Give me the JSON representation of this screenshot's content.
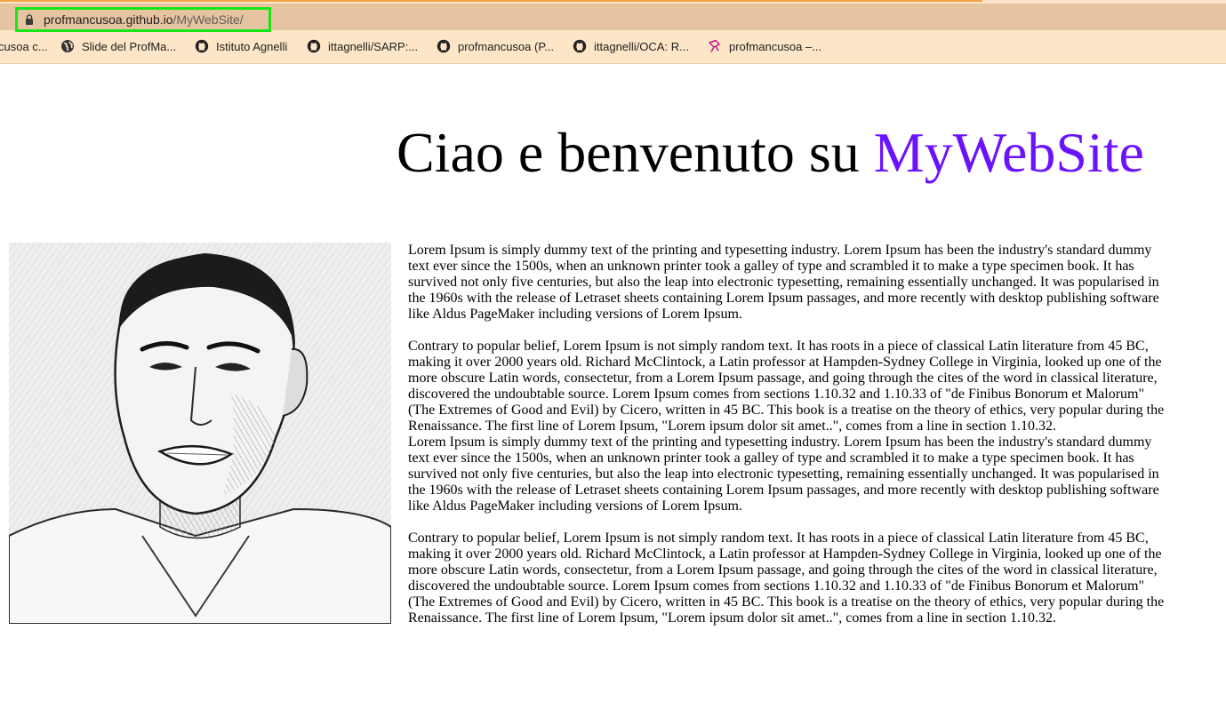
{
  "browser": {
    "url_domain": "profmancusoa.github.io",
    "url_path": "/MyWebSite/",
    "bookmarks": [
      {
        "label": "cusoa c...",
        "icon": "none"
      },
      {
        "label": "Slide del ProfMa...",
        "icon": "globe-icon"
      },
      {
        "label": "Istituto Agnelli",
        "icon": "github-icon"
      },
      {
        "label": "ittagnelli/SARP:...",
        "icon": "github-icon"
      },
      {
        "label": "profmancusoa (P...",
        "icon": "github-icon"
      },
      {
        "label": "ittagnelli/OCA: R...",
        "icon": "github-icon"
      },
      {
        "label": "profmancusoa –...",
        "icon": "pen-icon"
      }
    ]
  },
  "page": {
    "title_prefix": "Ciao e benvenuto su ",
    "title_brand": "MyWebSite",
    "paragraphs": [
      "Lorem Ipsum is simply dummy text of the printing and typesetting industry. Lorem Ipsum has been the industry's standard dummy text ever since the 1500s, when an unknown printer took a galley of type and scrambled it to make a type specimen book. It has survived not only five centuries, but also the leap into electronic typesetting, remaining essentially unchanged. It was popularised in the 1960s with the release of Letraset sheets containing Lorem Ipsum passages, and more recently with desktop publishing software like Aldus PageMaker including versions of Lorem Ipsum.",
      "Contrary to popular belief, Lorem Ipsum is not simply random text. It has roots in a piece of classical Latin literature from 45 BC, making it over 2000 years old. Richard McClintock, a Latin professor at Hampden-Sydney College in Virginia, looked up one of the more obscure Latin words, consectetur, from a Lorem Ipsum passage, and going through the cites of the word in classical literature, discovered the undoubtable source. Lorem Ipsum comes from sections 1.10.32 and 1.10.33 of \"de Finibus Bonorum et Malorum\" (The Extremes of Good and Evil) by Cicero, written in 45 BC. This book is a treatise on the theory of ethics, very popular during the Renaissance. The first line of Lorem Ipsum, \"Lorem ipsum dolor sit amet..\", comes from a line in section 1.10.32.",
      "Lorem Ipsum is simply dummy text of the printing and typesetting industry. Lorem Ipsum has been the industry's standard dummy text ever since the 1500s, when an unknown printer took a galley of type and scrambled it to make a type specimen book. It has survived not only five centuries, but also the leap into electronic typesetting, remaining essentially unchanged. It was popularised in the 1960s with the release of Letraset sheets containing Lorem Ipsum passages, and more recently with desktop publishing software like Aldus PageMaker including versions of Lorem Ipsum.",
      "Contrary to popular belief, Lorem Ipsum is not simply random text. It has roots in a piece of classical Latin literature from 45 BC, making it over 2000 years old. Richard McClintock, a Latin professor at Hampden-Sydney College in Virginia, looked up one of the more obscure Latin words, consectetur, from a Lorem Ipsum passage, and going through the cites of the word in classical literature, discovered the undoubtable source. Lorem Ipsum comes from sections 1.10.32 and 1.10.33 of \"de Finibus Bonorum et Malorum\" (The Extremes of Good and Evil) by Cicero, written in 45 BC. This book is a treatise on the theory of ethics, very popular during the Renaissance. The first line of Lorem Ipsum, \"Lorem ipsum dolor sit amet..\", comes from a line in section 1.10.32."
    ]
  },
  "colors": {
    "brand": "#6b12ff",
    "url_highlight": "#19e619",
    "chrome_bg": "#fde5c7"
  }
}
